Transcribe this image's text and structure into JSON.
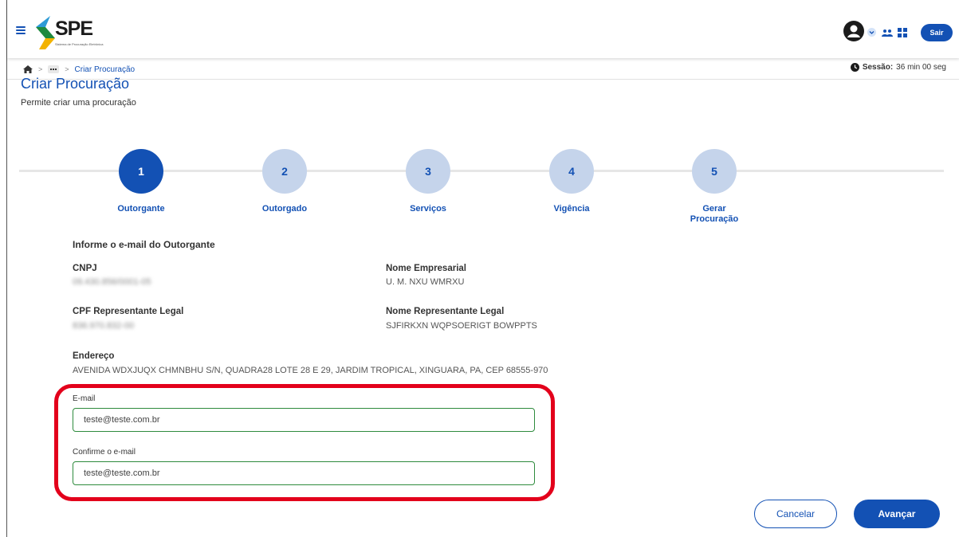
{
  "header": {
    "logo_text": "SPE",
    "logo_subtitle": "Sistema de Procuração Eletrônica",
    "logout_label": "Sair"
  },
  "breadcrumb": {
    "current": "Criar Procuração"
  },
  "session": {
    "label": "Sessão:",
    "time": "36 min 00 seg"
  },
  "page": {
    "title": "Criar Procuração",
    "subtitle": "Permite criar uma procuração"
  },
  "steps": [
    {
      "number": "1",
      "label": "Outorgante",
      "active": true
    },
    {
      "number": "2",
      "label": "Outorgado",
      "active": false
    },
    {
      "number": "3",
      "label": "Serviços",
      "active": false
    },
    {
      "number": "4",
      "label": "Vigência",
      "active": false
    },
    {
      "number": "5",
      "label": "Gerar Procuração",
      "active": false
    }
  ],
  "form": {
    "section_title": "Informe o e-mail do Outorgante",
    "cnpj_label": "CNPJ",
    "cnpj_value": "09.430.856/0001-05",
    "company_label": "Nome Empresarial",
    "company_value": "U. M. NXU WMRXU",
    "cpf_label": "CPF Representante Legal",
    "cpf_value": "836.970.832-00",
    "rep_label": "Nome Representante Legal",
    "rep_value": "SJFIRKXN WQPSOERIGT BOWPPTS",
    "address_label": "Endereço",
    "address_value": "AVENIDA WDXJUQX CHMNBHU S/N, QUADRA28 LOTE 28 E 29, JARDIM TROPICAL, XINGUARA, PA, CEP 68555-970",
    "email_label": "E-mail",
    "email_value": "teste@teste.com.br",
    "confirm_label": "Confirme o e-mail",
    "confirm_value": "teste@teste.com.br"
  },
  "actions": {
    "cancel": "Cancelar",
    "next": "Avançar"
  },
  "colors": {
    "primary": "#1351b4",
    "step_inactive": "#c5d4eb",
    "input_border": "#2e8b3d",
    "highlight": "#e3001b"
  }
}
